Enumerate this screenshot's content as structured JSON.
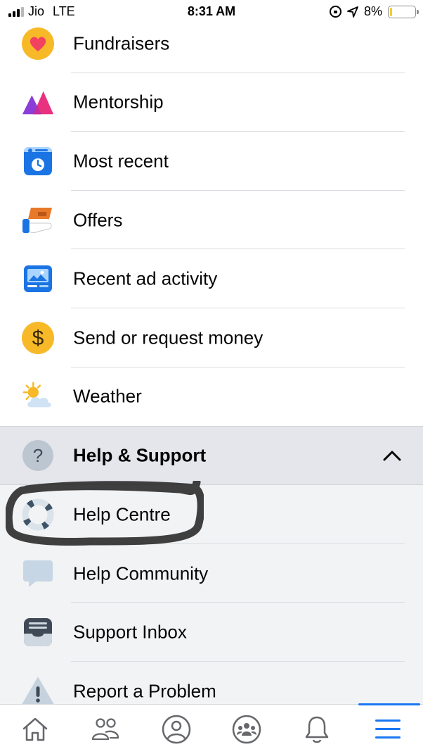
{
  "status_bar": {
    "carrier": "Jio",
    "network": "LTE",
    "time": "8:31 AM",
    "battery": "8%",
    "battery_level": 0.08
  },
  "menu_items": [
    {
      "label": "Fundraisers",
      "icon": "heart-icon"
    },
    {
      "label": "Mentorship",
      "icon": "mentorship-icon"
    },
    {
      "label": "Most recent",
      "icon": "most-recent-icon"
    },
    {
      "label": "Offers",
      "icon": "offers-icon"
    },
    {
      "label": "Recent ad activity",
      "icon": "ad-activity-icon"
    },
    {
      "label": "Send or request money",
      "icon": "dollar-icon"
    },
    {
      "label": "Weather",
      "icon": "weather-icon"
    }
  ],
  "help_support": {
    "label": "Help & Support",
    "icon": "question-icon",
    "expanded": true,
    "items": [
      {
        "label": "Help Centre",
        "icon": "lifebuoy-icon"
      },
      {
        "label": "Help Community",
        "icon": "chat-bubble-icon"
      },
      {
        "label": "Support Inbox",
        "icon": "inbox-icon"
      },
      {
        "label": "Report a Problem",
        "icon": "warning-icon"
      }
    ]
  },
  "bottom_nav": [
    {
      "name": "home",
      "icon": "home-icon"
    },
    {
      "name": "friends",
      "icon": "friends-icon"
    },
    {
      "name": "profile",
      "icon": "profile-icon"
    },
    {
      "name": "groups",
      "icon": "groups-icon"
    },
    {
      "name": "notifications",
      "icon": "bell-icon"
    },
    {
      "name": "menu",
      "icon": "hamburger-icon",
      "active": true
    }
  ],
  "colors": {
    "accent": "#1877f2",
    "divider": "#dadde1",
    "section_bg": "#e4e6eb",
    "sub_bg": "#f2f3f5",
    "marker": "#2b2b2b"
  }
}
